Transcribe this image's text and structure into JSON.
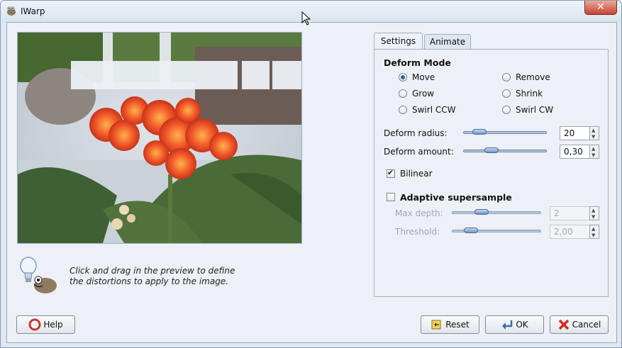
{
  "window": {
    "title": "IWarp"
  },
  "hint": {
    "text": "Click and drag in the preview to define\nthe distortions to apply to the image."
  },
  "tabs": [
    {
      "label": "Settings"
    },
    {
      "label": "Animate"
    }
  ],
  "deform_mode": {
    "title": "Deform Mode",
    "options": [
      {
        "label": "Move",
        "selected": true
      },
      {
        "label": "Remove",
        "selected": false
      },
      {
        "label": "Grow",
        "selected": false
      },
      {
        "label": "Shrink",
        "selected": false
      },
      {
        "label": "Swirl CCW",
        "selected": false
      },
      {
        "label": "Swirl CW",
        "selected": false
      }
    ]
  },
  "deform_radius": {
    "label": "Deform radius:",
    "value": "20",
    "level": 0.12
  },
  "deform_amount": {
    "label": "Deform amount:",
    "value": "0,30",
    "level": 0.3
  },
  "bilinear": {
    "label": "Bilinear",
    "checked": true
  },
  "adaptive": {
    "label": "Adaptive supersample",
    "checked": false
  },
  "max_depth": {
    "label": "Max depth:",
    "value": "2",
    "level": 0.3
  },
  "threshold": {
    "label": "Threshold:",
    "value": "2,00",
    "level": 0.15
  },
  "buttons": {
    "help": "Help",
    "reset": "Reset",
    "ok": "OK",
    "cancel": "Cancel"
  },
  "colors": {
    "accent": "#3a5f8e",
    "flower": "#f2592a",
    "leaf": "#3f5f34"
  }
}
